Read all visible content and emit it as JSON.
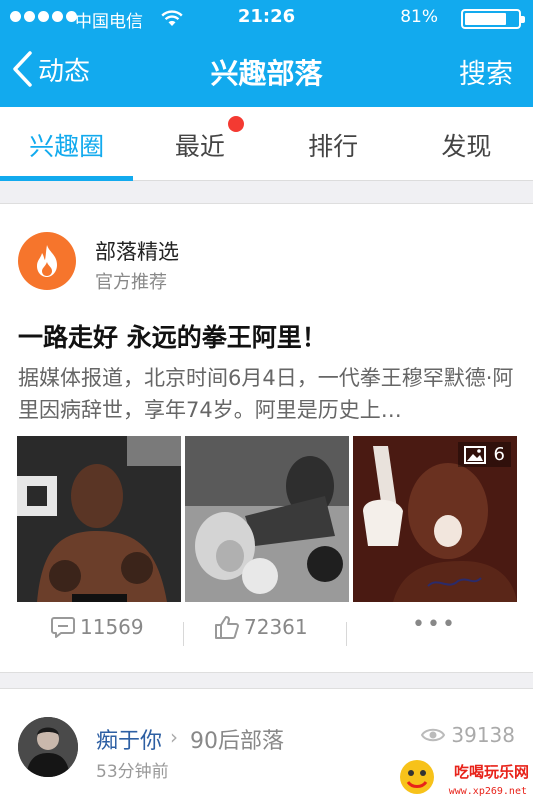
{
  "status_bar": {
    "carrier": "中国电信",
    "time": "21:26",
    "battery_percent": "81%",
    "battery_level": 0.81
  },
  "nav": {
    "back_label": "动态",
    "title": "兴趣部落",
    "search_label": "搜索"
  },
  "tabs": [
    {
      "label": "兴趣圈",
      "active": true
    },
    {
      "label": "最近",
      "active": false,
      "badge": true
    },
    {
      "label": "排行",
      "active": false
    },
    {
      "label": "发现",
      "active": false
    }
  ],
  "post": {
    "source_name": "部落精选",
    "source_sub": "官方推荐",
    "title": "一路走好 永远的拳王阿里！",
    "body": "据媒体报道，北京时间6月4日，一代拳王穆罕默德·阿里因病辞世，享年74岁。阿里是历史上…",
    "image_count": "6",
    "comments": "11569",
    "likes": "72361",
    "more": "•••"
  },
  "post2": {
    "user_name": "痴于你",
    "group_name": "90后部落",
    "time": "53分钟前",
    "views": "39138"
  },
  "watermark": {
    "text": "吃喝玩乐网",
    "url": "www.xp269.net"
  },
  "colors": {
    "brand": "#12aaee",
    "badge_red": "#f43a32",
    "source_avatar": "#f6752c",
    "user_link": "#2d5fa3"
  },
  "icons": [
    "wifi-icon",
    "battery-icon",
    "back-chevron-icon",
    "fire-icon",
    "image-gallery-icon",
    "comment-icon",
    "thumbs-up-icon",
    "more-icon",
    "eye-icon"
  ]
}
